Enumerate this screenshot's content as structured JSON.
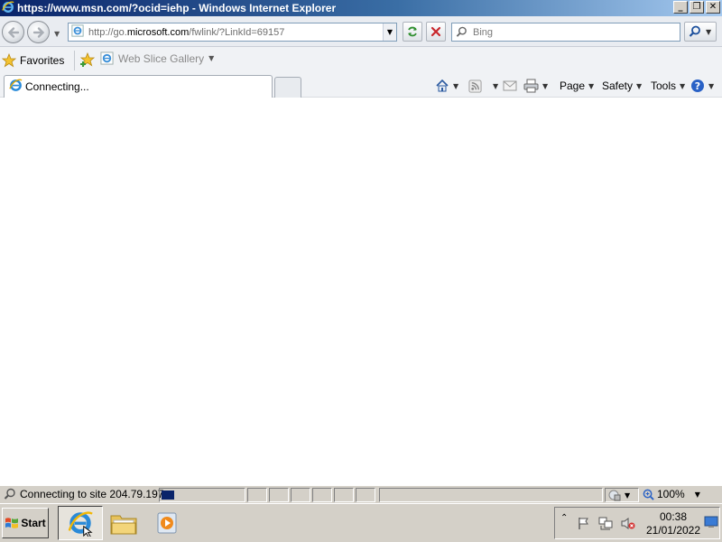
{
  "window": {
    "title": "https://www.msn.com/?ocid=iehp - Windows Internet Explorer"
  },
  "address_bar": {
    "url_prefix": "http://go.",
    "url_domain": "microsoft.com",
    "url_suffix": "/fwlink/?LinkId=69157"
  },
  "search": {
    "placeholder": "Bing"
  },
  "favorites_bar": {
    "favorites_label": "Favorites",
    "web_slice_label": "Web Slice Gallery"
  },
  "tab": {
    "label": "Connecting..."
  },
  "command_bar": {
    "page_label": "Page",
    "safety_label": "Safety",
    "tools_label": "Tools"
  },
  "status_bar": {
    "status_text": "Connecting to site 204.79.197.",
    "zoom_label": "100%",
    "progress_fraction": 0.15
  },
  "taskbar": {
    "start_label": "Start",
    "clock_time": "00:38",
    "clock_date": "21/01/2022"
  },
  "colors": {
    "title_gradient_start": "#0a246a",
    "title_gradient_end": "#a6caf0",
    "progress_fill": "#0a246a",
    "chrome_gray": "#d4d0c8"
  }
}
